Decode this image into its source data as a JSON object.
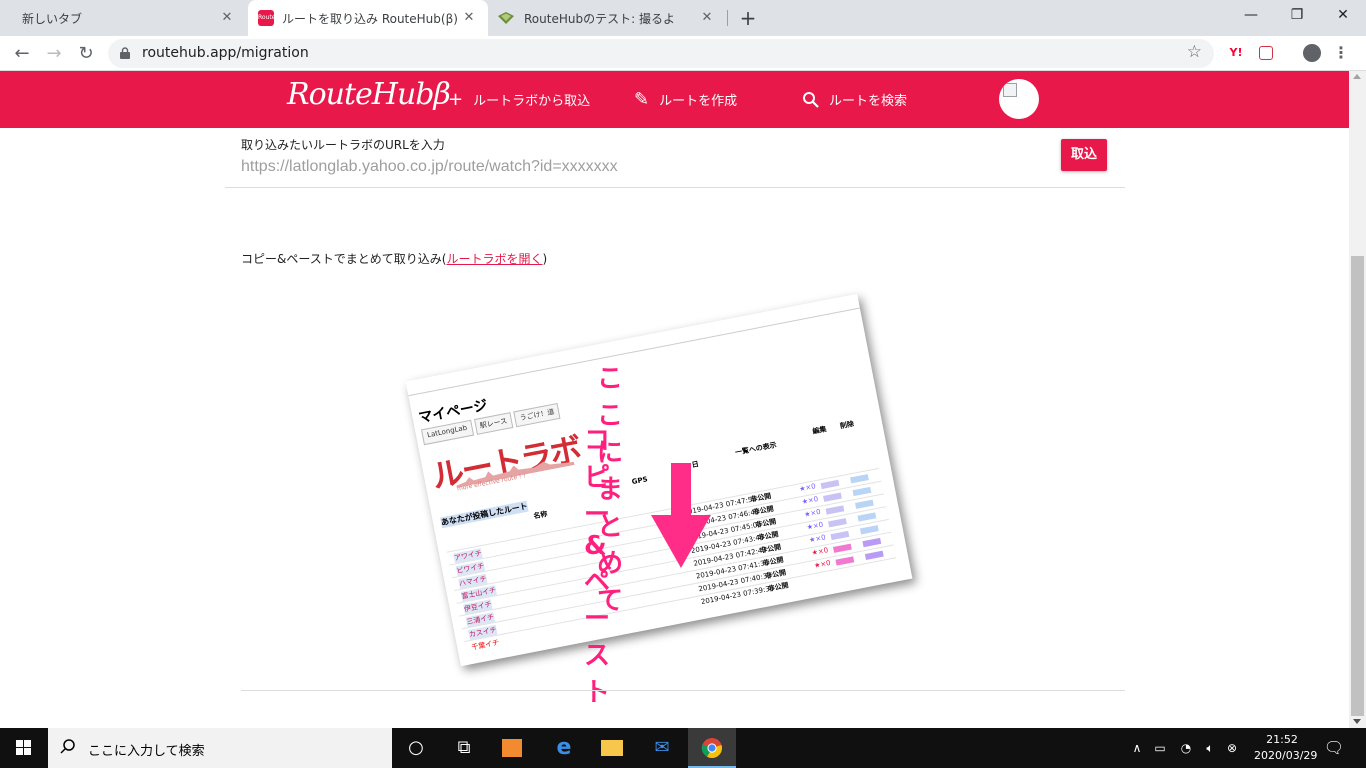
{
  "browser": {
    "tabs": [
      {
        "title": "新しいタブ"
      },
      {
        "title": "ルートを取り込み RouteHub(β)",
        "favicon_text": "Route"
      },
      {
        "title": "RouteHubのテスト: 撮るよ"
      }
    ],
    "new_tab": "+",
    "url": "routehub.app/migration",
    "colors": {
      "tabstrip": "#dee1e6",
      "toolbar": "#ffffff"
    }
  },
  "header": {
    "logo": "RouteHubβ",
    "nav": [
      {
        "label": "ルートラボから取込",
        "icon": "plus-icon"
      },
      {
        "label": "ルートを作成",
        "icon": "pencil-icon"
      },
      {
        "label": "ルートを検索",
        "icon": "search-icon"
      }
    ],
    "color": "#e8194a"
  },
  "main": {
    "url_label": "取り込みたいルートラボのURLを入力",
    "url_placeholder": "https://latlonglab.yahoo.co.jp/route/watch?id=xxxxxxx",
    "import_button": "取込",
    "paste_text": "コピー&ペーストでまとめて取り込み(",
    "paste_link": "ルートラボを開く",
    "paste_close": ")"
  },
  "illustration": {
    "mypage_title": "マイページ",
    "service_tabs": [
      "LatLongLab",
      "駅レース",
      "うごけ！道"
    ],
    "routelabo_logo": "ルートラボ",
    "routelabo_sub": "more effective route ! !",
    "overlay_line1": "ここにまとめて",
    "overlay_line2": "コピー&ペースト",
    "your_routes": "あなたが投稿したルート",
    "col_name": "名称",
    "col_gps": "GPS",
    "col_date": "日",
    "col_list": "一覧への表示",
    "col_edit": "編集",
    "col_delete": "削除",
    "rows": [
      {
        "name": "アワイチ",
        "date": "2019-04-23 07:47:56",
        "visibility": "非公開",
        "stars": "★×0"
      },
      {
        "name": "ビワイチ",
        "date": "2019-04-23 07:46:48",
        "visibility": "非公開",
        "stars": "★×0"
      },
      {
        "name": "ハマイチ",
        "date": "2019-04-23 07:45:06",
        "visibility": "非公開",
        "stars": "★×0"
      },
      {
        "name": "富士山イチ",
        "date": "2019-04-23 07:43:48",
        "visibility": "非公開",
        "stars": "★×0"
      },
      {
        "name": "伊豆イチ",
        "date": "2019-04-23 07:42:43",
        "visibility": "非公開",
        "stars": "★×0"
      },
      {
        "name": "三浦イチ",
        "date": "2019-04-23 07:41:36",
        "visibility": "非公開",
        "stars": "★×0"
      },
      {
        "name": "カスイチ",
        "date": "2019-04-23 07:40:38",
        "visibility": "非公開",
        "stars": "★×0"
      },
      {
        "name": "千葉イチ",
        "date": "2019-04-23 07:39:38",
        "visibility": "非公開",
        "stars": "★×0"
      }
    ]
  },
  "taskbar": {
    "search_placeholder": "ここに入力して検索",
    "time": "21:52",
    "date": "2020/03/29"
  }
}
